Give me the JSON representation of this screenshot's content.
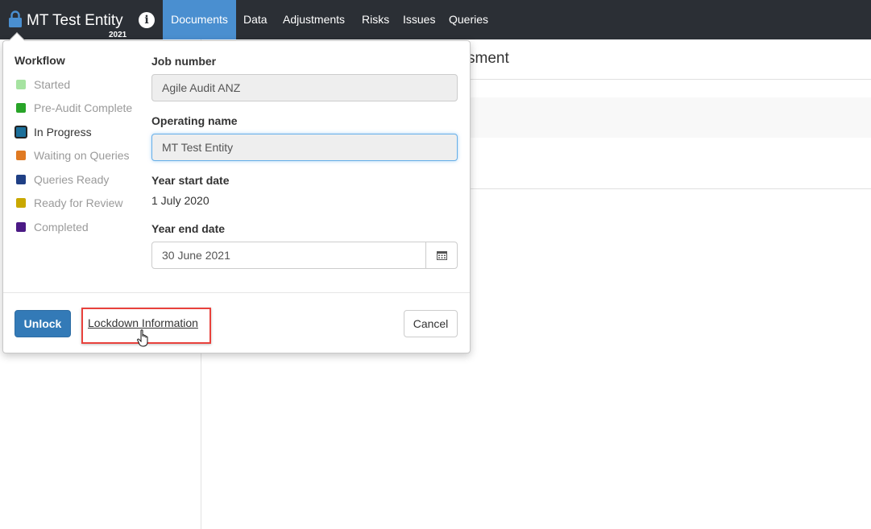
{
  "header": {
    "entity_name": "MT Test Entity",
    "year": "2021",
    "info_glyph": "i",
    "tabs": [
      {
        "label": "Documents",
        "active": true
      },
      {
        "label": "Data",
        "active": false
      },
      {
        "label": "Adjustments",
        "active": false
      },
      {
        "label": "Risks",
        "active": false
      },
      {
        "label": "Issues",
        "active": false
      },
      {
        "label": "Queries",
        "active": false
      }
    ],
    "colors": {
      "bar": "#2b2f35",
      "active_tab": "#4a8fd0"
    }
  },
  "background": {
    "title_fragment": "sment"
  },
  "popover": {
    "workflow": {
      "heading": "Workflow",
      "items": [
        {
          "label": "Started",
          "color": "#a6e3a1",
          "current": false
        },
        {
          "label": "Pre-Audit Complete",
          "color": "#28a428",
          "current": false
        },
        {
          "label": "In Progress",
          "color": "#1b6f9a",
          "current": true
        },
        {
          "label": "Waiting on Queries",
          "color": "#e07a22",
          "current": false
        },
        {
          "label": "Queries Ready",
          "color": "#1f3f85",
          "current": false
        },
        {
          "label": "Ready for Review",
          "color": "#c9a800",
          "current": false
        },
        {
          "label": "Completed",
          "color": "#4b1a85",
          "current": false
        }
      ]
    },
    "fields": {
      "job_number_label": "Job number",
      "job_number_value": "Agile Audit ANZ",
      "operating_name_label": "Operating name",
      "operating_name_value": "MT Test Entity",
      "year_start_label": "Year start date",
      "year_start_value": "1 July 2020",
      "year_end_label": "Year end date",
      "year_end_value": "30 June 2021"
    },
    "buttons": {
      "unlock": "Unlock",
      "lockdown_info": "Lockdown Information",
      "cancel": "Cancel"
    },
    "highlight_color": "#e8413c"
  },
  "icons": {
    "lock": "lock-icon",
    "info": "info-icon",
    "calendar": "calendar-icon",
    "cursor": "hand-pointer-cursor"
  }
}
